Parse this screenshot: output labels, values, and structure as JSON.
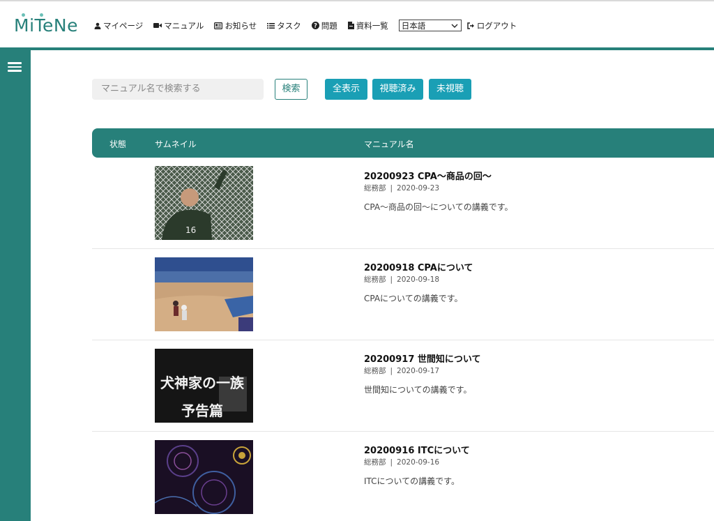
{
  "app": {
    "logo_text": "MiTeNe"
  },
  "nav": {
    "mypage": "マイページ",
    "manual": "マニュアル",
    "news": "お知らせ",
    "task": "タスク",
    "question": "問題",
    "documents": "資料一覧",
    "language": "日本語",
    "logout": "ログアウト"
  },
  "search": {
    "placeholder": "マニュアル名で検索する",
    "button": "検索"
  },
  "filters": {
    "all": "全表示",
    "watched": "視聴済み",
    "unwatched": "未視聴"
  },
  "table": {
    "col_status": "状態",
    "col_thumbnail": "サムネイル",
    "col_name": "マニュアル名"
  },
  "manuals": [
    {
      "title": "20200923 CPA〜商品の回〜",
      "department": "総務部",
      "date": "2020-09-23",
      "description": "CPA〜商品の回〜についての講義です。"
    },
    {
      "title": "20200918 CPAについて",
      "department": "総務部",
      "date": "2020-09-18",
      "description": "CPAについての講義です。"
    },
    {
      "title": "20200917 世間知について",
      "department": "総務部",
      "date": "2020-09-17",
      "description": "世間知についての講義です。",
      "thumbnail_text_1": "犬神家の一族",
      "thumbnail_text_2": "予告篇"
    },
    {
      "title": "20200916 ITCについて",
      "department": "総務部",
      "date": "2020-09-16",
      "description": "ITCについての講義です。"
    }
  ],
  "colors": {
    "brand": "#27807a",
    "accent": "#1a9fb5",
    "logo_dot": "#6cc0b7"
  },
  "icons": {
    "mypage": "user-icon",
    "manual": "video-camera-icon",
    "news": "newspaper-icon",
    "task": "list-icon",
    "question": "question-circle-icon",
    "documents": "file-icon",
    "logout": "sign-out-icon",
    "menu": "hamburger-icon"
  }
}
